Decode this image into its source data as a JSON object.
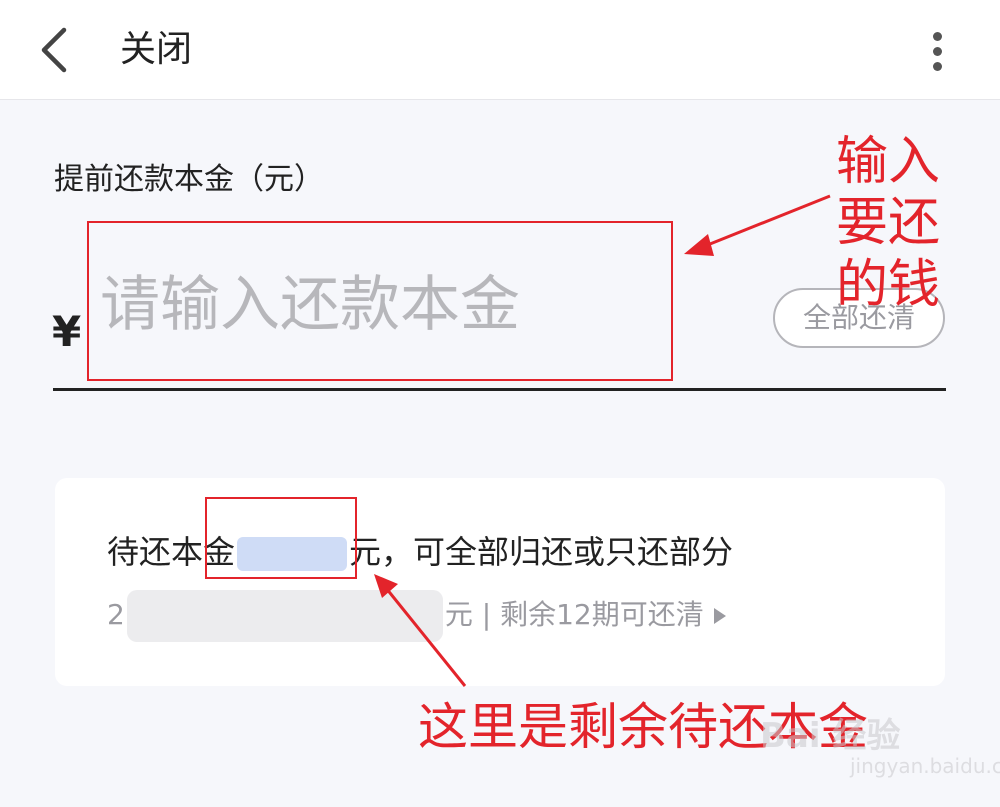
{
  "header": {
    "back_icon": "chevron-left-icon",
    "title": "关闭",
    "more_icon": "vertical-dots-icon"
  },
  "form": {
    "label": "提前还款本金（元）",
    "currency_symbol": "¥",
    "amount_placeholder": "请输入还款本金",
    "amount_value": "",
    "repay_all_label": "全部还清"
  },
  "info_card": {
    "pending_prefix": "待还本金",
    "pending_suffix": "元，可全部归还或只还部分",
    "sub_prefix": "2",
    "sub_suffix": "元 | 剩余12期可还清"
  },
  "annotations": {
    "color": "#e3242b",
    "input_hint": "输入\n要还\n的钱",
    "bottom_hint": "这里是剩余待还本金"
  },
  "watermark": {
    "logo": "Bai 经验",
    "url": "jingyan.baidu.com"
  }
}
